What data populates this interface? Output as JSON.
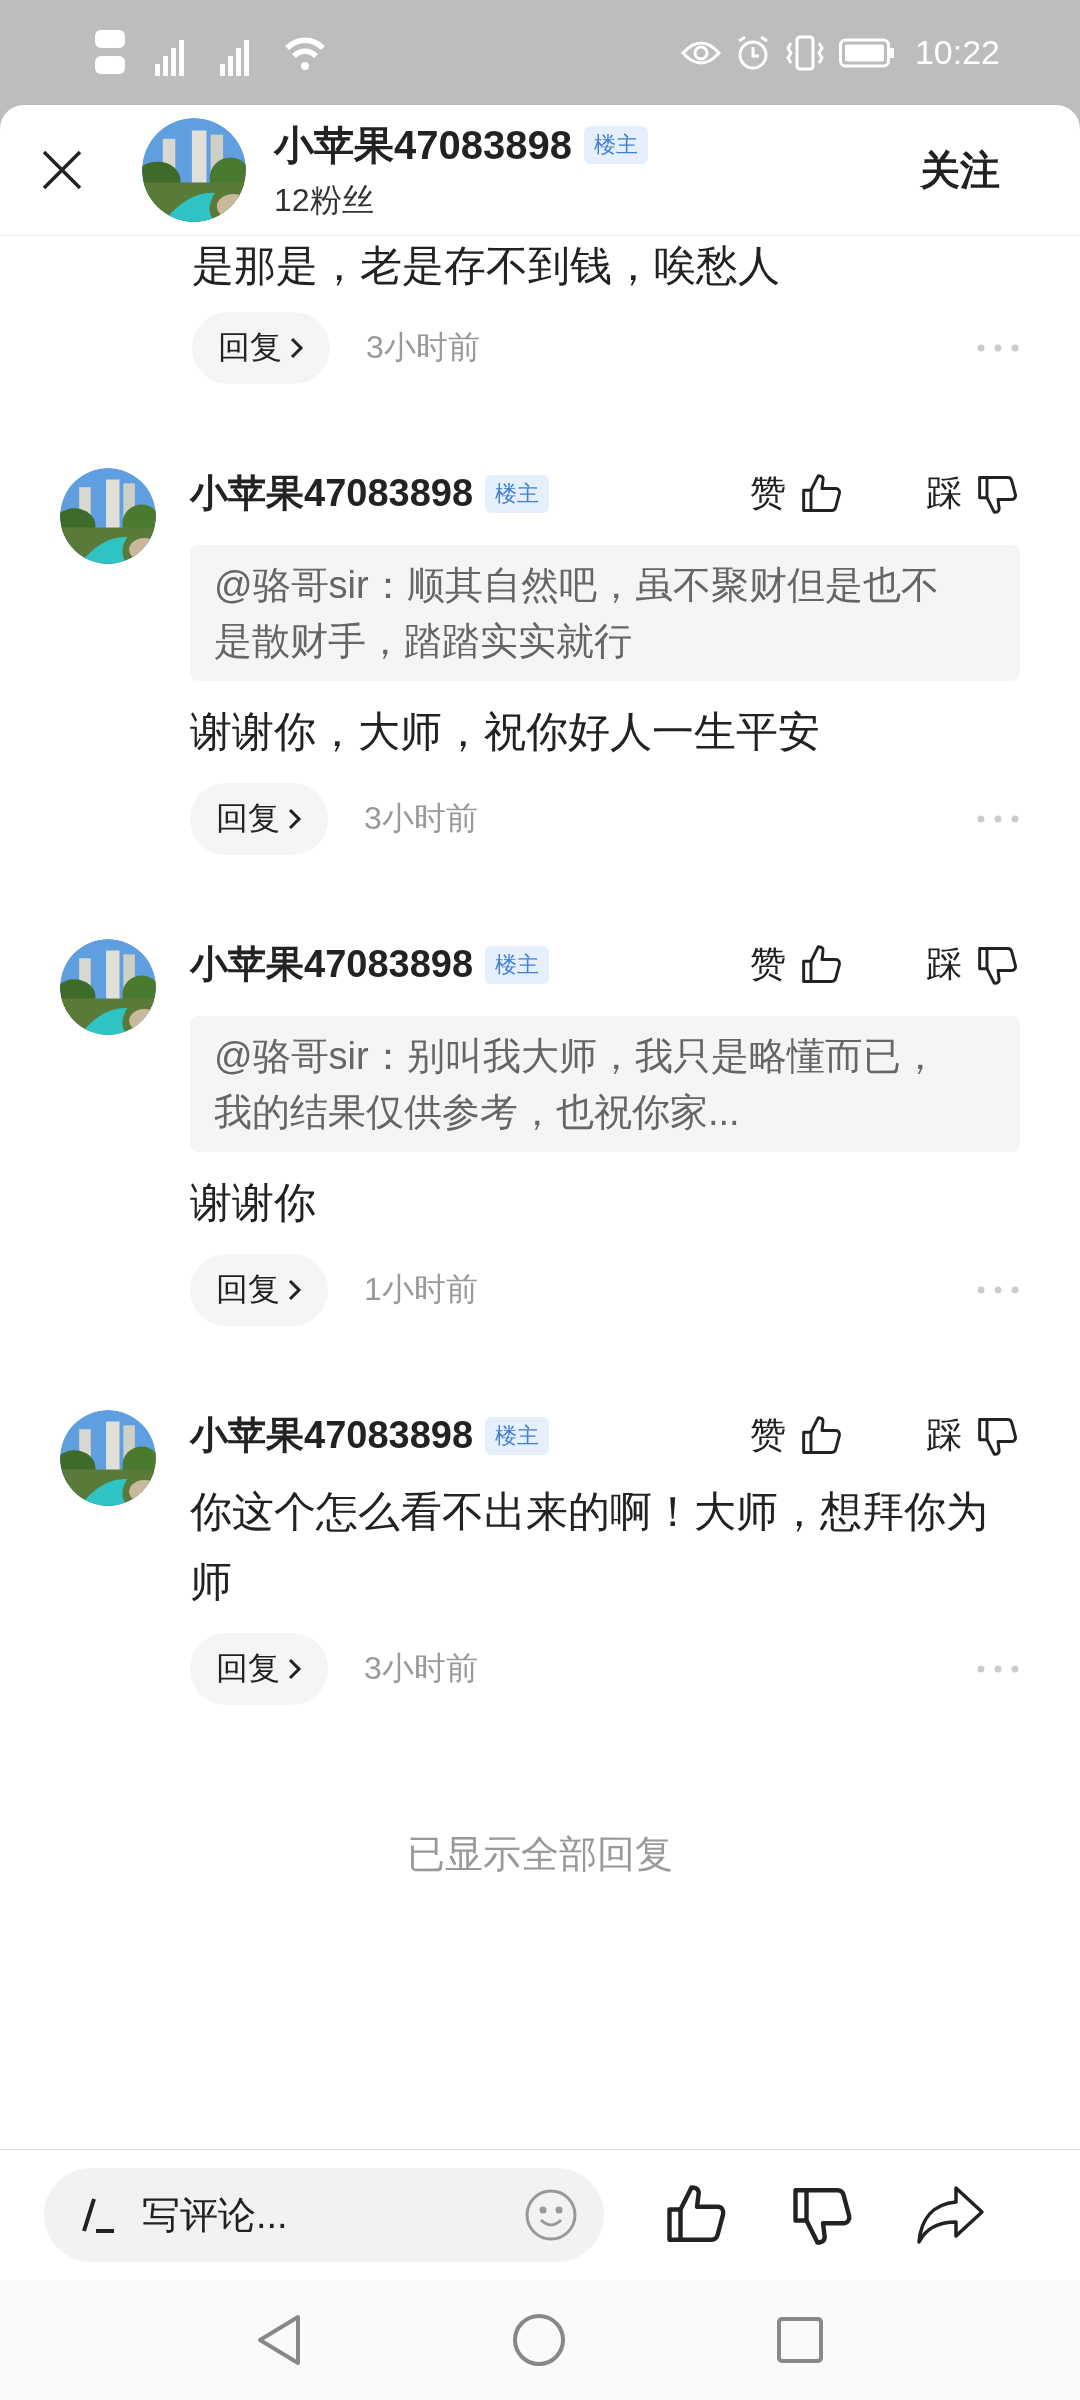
{
  "status_bar": {
    "time": "10:22"
  },
  "header": {
    "name": "小苹果47083898",
    "badge": "楼主",
    "followers": "12粉丝",
    "follow_label": "关注"
  },
  "partial_comment": {
    "text": "是那是，老是存不到钱，唉愁人",
    "reply_label": "回复",
    "time": "3小时前"
  },
  "comments": [
    {
      "name": "小苹果47083898",
      "badge": "楼主",
      "like_label": "赞",
      "dislike_label": "踩",
      "quote": "@骆哥sir：顺其自然吧，虽不聚财但是也不是散财手，踏踏实实就行",
      "text": "谢谢你，大师，祝你好人一生平安",
      "reply_label": "回复",
      "time": "3小时前"
    },
    {
      "name": "小苹果47083898",
      "badge": "楼主",
      "like_label": "赞",
      "dislike_label": "踩",
      "quote": "@骆哥sir：别叫我大师，我只是略懂而已，我的结果仅供参考，也祝你家...",
      "text": "谢谢你",
      "reply_label": "回复",
      "time": "1小时前"
    },
    {
      "name": "小苹果47083898",
      "badge": "楼主",
      "like_label": "赞",
      "dislike_label": "踩",
      "text": "你这个怎么看不出来的啊！大师，想拜你为师",
      "reply_label": "回复",
      "time": "3小时前"
    }
  ],
  "end_note": "已显示全部回复",
  "bottom_bar": {
    "placeholder": "写评论..."
  }
}
